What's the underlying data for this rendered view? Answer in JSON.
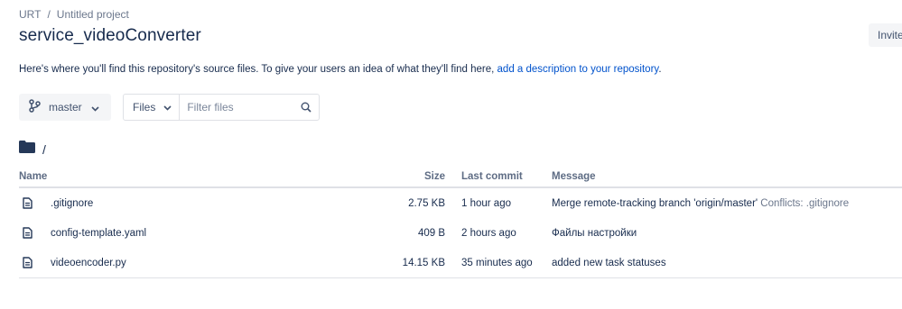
{
  "breadcrumb": {
    "workspace": "URT",
    "separator": "/",
    "project": "Untitled project"
  },
  "repository": {
    "title": "service_videoConverter"
  },
  "header": {
    "invite_label": "Invite"
  },
  "description": {
    "text": "Here's where you'll find this repository's source files. To give your users an idea of what they'll find here, ",
    "link_text": "add a description to your repository",
    "trailing": "."
  },
  "toolbar": {
    "branch_label": "master",
    "files_select_value": "Files",
    "filter_placeholder": "Filter files"
  },
  "path": {
    "current": "/"
  },
  "table": {
    "headers": {
      "name": "Name",
      "size": "Size",
      "last_commit": "Last commit",
      "message": "Message"
    },
    "rows": [
      {
        "name": ".gitignore",
        "size": "2.75 KB",
        "last_commit": "1 hour ago",
        "message": "Merge remote-tracking branch 'origin/master'",
        "message_extra": "Conflicts: .gitignore"
      },
      {
        "name": "config-template.yaml",
        "size": "409 B",
        "last_commit": "2 hours ago",
        "message": "Файлы настройки",
        "message_extra": ""
      },
      {
        "name": "videoencoder.py",
        "size": "14.15 KB",
        "last_commit": "35 minutes ago",
        "message": "added new task statuses",
        "message_extra": ""
      }
    ]
  },
  "icons": {
    "branch": "branch-icon",
    "chevron": "chevron-down-icon",
    "search": "search-icon",
    "folder": "folder-icon",
    "file": "file-icon"
  },
  "colors": {
    "link": "#0052cc",
    "text": "#172b4d",
    "muted": "#6b778c",
    "border": "#dfe1e6"
  }
}
